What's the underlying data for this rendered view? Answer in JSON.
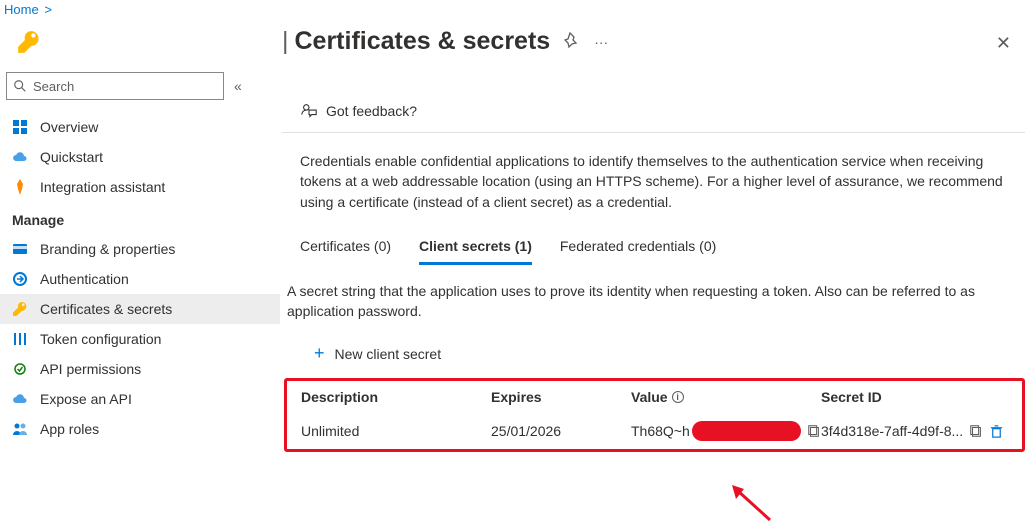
{
  "breadcrumb": {
    "home": "Home"
  },
  "title": "Certificates & secrets",
  "search": {
    "placeholder": "Search"
  },
  "nav": {
    "overview": "Overview",
    "quickstart": "Quickstart",
    "integration": "Integration assistant",
    "manage_header": "Manage",
    "branding": "Branding & properties",
    "auth": "Authentication",
    "certs": "Certificates & secrets",
    "tokencfg": "Token configuration",
    "apiperm": "API permissions",
    "expose": "Expose an API",
    "approles": "App roles"
  },
  "feedback": "Got feedback?",
  "intro": "Credentials enable confidential applications to identify themselves to the authentication service when receiving tokens at a web addressable location (using an HTTPS scheme). For a higher level of assurance, we recommend using a certificate (instead of a client secret) as a credential.",
  "tabs": {
    "certs": "Certificates (0)",
    "secrets": "Client secrets (1)",
    "federated": "Federated credentials (0)"
  },
  "subdesc": "A secret string that the application uses to prove its identity when requesting a token. Also can be referred to as application password.",
  "add_secret": "New client secret",
  "columns": {
    "description": "Description",
    "expires": "Expires",
    "value": "Value",
    "secretid": "Secret ID"
  },
  "row": {
    "description": "Unlimited",
    "expires": "25/01/2026",
    "value": "Th68Q~h",
    "secretid": "3f4d318e-7aff-4d9f-8..."
  }
}
